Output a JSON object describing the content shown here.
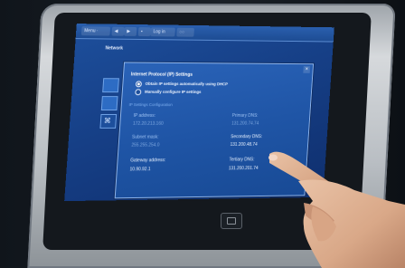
{
  "topbar": {
    "home_label": "Menu ·",
    "login_label": "Log in"
  },
  "page": {
    "title": "Network"
  },
  "dialog": {
    "title": "Internet Protocol (IP) Settings",
    "radio_auto": "Obtain IP settings automatically using DHCP",
    "radio_manual": "Manually configure IP settings",
    "radio_auto_selected": true,
    "dns_heading": "IP Settings Configuration",
    "ip_address_label": "IP address:",
    "ip_address_value": "172.20.213.160",
    "primary_dns_label": "Primary DNS:",
    "primary_dns_value": "131.200.74.74",
    "subnet_label": "Subnet mask:",
    "subnet_value": "255.255.254.0",
    "secondary_dns_label": "Secondary DNS:",
    "secondary_dns_value": "131.200.48.74",
    "gateway_label": "Gateway address:",
    "gateway_value": "10.90.92.1",
    "tertiary_dns_label": "Tertiary DNS:",
    "tertiary_dns_value": "131.200.201.74",
    "close_glyph": "×"
  },
  "icons": {
    "network": "network-icon",
    "close": "close-icon",
    "back": "back-arrow-icon",
    "forward": "forward-arrow-icon",
    "lock": "lock-icon",
    "toggle": "toggle-icon",
    "home_button": "home-button-icon"
  },
  "colors": {
    "screen_blue": "#1d4f9c",
    "dialog_blue": "#1f55a6",
    "bezel": "#14181d",
    "frame_silver": "#c3c8cc"
  }
}
